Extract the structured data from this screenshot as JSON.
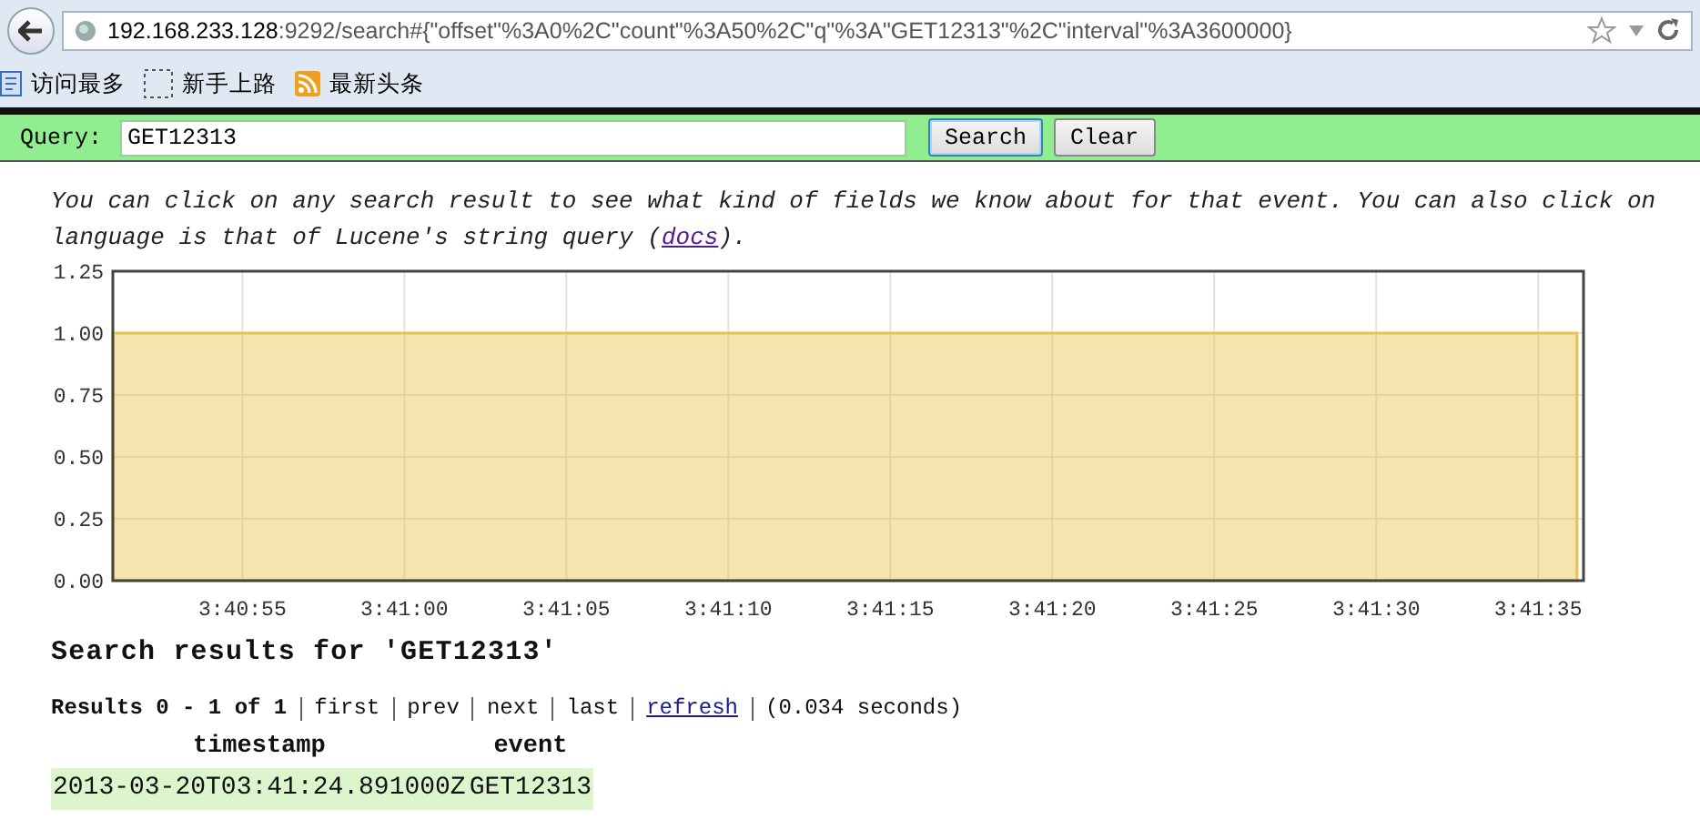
{
  "browser": {
    "url_host": "192.168.233.128",
    "url_rest": ":9292/search#{\"offset\"%3A0%2C\"count\"%3A50%2C\"q\"%3A\"GET12313\"%2C\"interval\"%3A3600000}",
    "bookmarks": [
      {
        "kind": "frequent",
        "label": "访问最多"
      },
      {
        "kind": "blank",
        "label": "新手上路"
      },
      {
        "kind": "feed",
        "label": "最新头条"
      }
    ]
  },
  "query_bar": {
    "label": "Query:",
    "value": "GET12313",
    "buttons": [
      {
        "label": "Search",
        "focused": true
      },
      {
        "label": "Clear",
        "focused": false
      }
    ]
  },
  "intro": {
    "line_1": "You can click on any search result to see what kind of fields we know about for that event. You can also click on",
    "line_2_before": "language is that of Lucene's string query (",
    "link": "docs",
    "line_2_after": ")."
  },
  "chart": {
    "chart_data": {
      "type": "area",
      "grid": true,
      "xlim": [
        13251,
        13296.4
      ],
      "ylim": [
        0,
        1.25
      ],
      "xticks": [
        {
          "value": 13255,
          "label": "3:40:55"
        },
        {
          "value": 13260,
          "label": "3:41:00"
        },
        {
          "value": 13265,
          "label": "3:41:05"
        },
        {
          "value": 13270,
          "label": "3:41:10"
        },
        {
          "value": 13275,
          "label": "3:41:15"
        },
        {
          "value": 13280,
          "label": "3:41:20"
        },
        {
          "value": 13285,
          "label": "3:41:25"
        },
        {
          "value": 13290,
          "label": "3:41:30"
        },
        {
          "value": 13295,
          "label": "3:41:35"
        }
      ],
      "yticks": [
        {
          "value": 0,
          "label": "0.00"
        },
        {
          "value": 0.25,
          "label": "0.25"
        },
        {
          "value": 0.5,
          "label": "0.50"
        },
        {
          "value": 0.75,
          "label": "0.75"
        },
        {
          "value": 1,
          "label": "1.00"
        },
        {
          "value": 1.25,
          "label": "1.25"
        }
      ],
      "x": [
        13251,
        13296.2
      ],
      "series": [
        {
          "color": "#e8c34a",
          "values": [
            1,
            1
          ]
        }
      ]
    }
  },
  "results": {
    "heading": "Search results for 'GET12313'",
    "summary": "Results 0 - 1 of 1",
    "nav": [
      {
        "label": "first",
        "kind": "plain"
      },
      {
        "label": "prev",
        "kind": "plain"
      },
      {
        "label": "next",
        "kind": "plain"
      },
      {
        "label": "last",
        "kind": "plain"
      },
      {
        "label": "refresh ",
        "kind": "link"
      },
      {
        "label": "(0.034 seconds)",
        "kind": "info"
      }
    ],
    "columns": [
      "timestamp",
      "event"
    ],
    "rows": [
      [
        "2013-03-20T03:41:24.891000Z",
        "GET12313"
      ]
    ]
  }
}
